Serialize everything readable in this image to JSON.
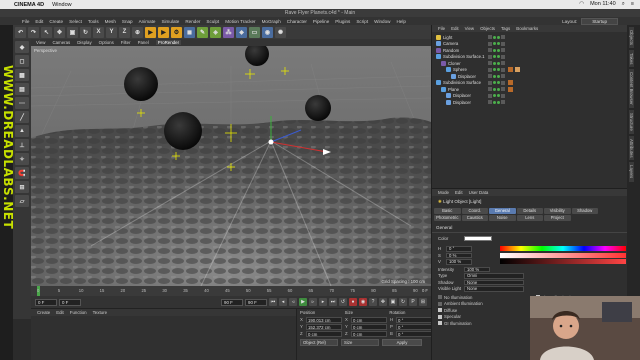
{
  "mac_menubar": {
    "app_name": "CINEMA 4D",
    "menus": [
      "Window"
    ],
    "clock": "Mon 11:40"
  },
  "window": {
    "title": "Rave Flyer Planets.c4d * - Main"
  },
  "app_menu": {
    "items": [
      "File",
      "Edit",
      "Create",
      "Select",
      "Tools",
      "Mesh",
      "Snap",
      "Animate",
      "Simulate",
      "Render",
      "Sculpt",
      "Motion Tracker",
      "MoGraph",
      "Character",
      "Pipeline",
      "Plugins",
      "Script",
      "Window",
      "Help"
    ],
    "layout_label": "Layout:",
    "layout_value": "Startup"
  },
  "toolbar": {
    "axis_buttons": [
      "X",
      "Y",
      "Z"
    ]
  },
  "watermark": {
    "text": "WWW.DREADLABS.NET"
  },
  "viewport": {
    "menu": [
      "View",
      "Cameras",
      "Display",
      "Options",
      "Filter",
      "Panel",
      "ProRender"
    ],
    "active_menu": "ProRender",
    "label": "Perspective",
    "grid_spacing": "Grid Spacing : 100 cm"
  },
  "timeline": {
    "ticks": [
      "0",
      "5",
      "10",
      "15",
      "20",
      "25",
      "30",
      "35",
      "40",
      "45",
      "50",
      "55",
      "60",
      "65",
      "70",
      "75",
      "80",
      "85",
      "90"
    ],
    "end_label": "0 F",
    "current_frame": "0 F",
    "start_field": "0 F",
    "end_field": "90 F",
    "end_field2": "90 F"
  },
  "material_panel": {
    "menu": [
      "Create",
      "Edit",
      "Function",
      "Texture"
    ]
  },
  "coordinates": {
    "headers": [
      "Position",
      "Size",
      "Rotation"
    ],
    "rows": [
      {
        "pos_key": "X",
        "pos": "190.013 cm",
        "size_key": "X",
        "size": "0 cm",
        "rot_key": "H",
        "rot": "0 °"
      },
      {
        "pos_key": "Y",
        "pos": "152.372 cm",
        "size_key": "Y",
        "size": "0 cm",
        "rot_key": "P",
        "rot": "0 °"
      },
      {
        "pos_key": "Z",
        "pos": "0 cm",
        "size_key": "Z",
        "size": "0 cm",
        "rot_key": "B",
        "rot": "0 °"
      }
    ],
    "mode_select": "Object (Rel)",
    "size_select": "Size",
    "apply_label": "Apply"
  },
  "object_manager": {
    "menu": [
      "File",
      "Edit",
      "View",
      "Objects",
      "Tags",
      "Bookmarks"
    ],
    "items": [
      {
        "name": "Light",
        "indent": 0,
        "icon_color": "#e0c040",
        "tags": 0
      },
      {
        "name": "Camera",
        "indent": 0,
        "icon_color": "#6aa0e0",
        "tags": 0
      },
      {
        "name": "Random",
        "indent": 0,
        "icon_color": "#7a5aa8",
        "tags": 0
      },
      {
        "name": "Subdivision Surface.1",
        "indent": 0,
        "icon_color": "#5aa0e0",
        "tags": 0
      },
      {
        "name": "Cloner",
        "indent": 1,
        "icon_color": "#7a5aa8",
        "tags": 0
      },
      {
        "name": "Sphere",
        "indent": 2,
        "icon_color": "#5aa0e0",
        "tags": 2
      },
      {
        "name": "Displacer",
        "indent": 3,
        "icon_color": "#6aa0e0",
        "tags": 0
      },
      {
        "name": "Subdivision Surface",
        "indent": 0,
        "icon_color": "#5aa0e0",
        "tags": 1
      },
      {
        "name": "Plane",
        "indent": 1,
        "icon_color": "#5aa0e0",
        "tags": 1
      },
      {
        "name": "Displacer",
        "indent": 2,
        "icon_color": "#6aa0e0",
        "tags": 0
      },
      {
        "name": "Displacer",
        "indent": 2,
        "icon_color": "#6aa0e0",
        "tags": 0
      }
    ]
  },
  "attribute_manager": {
    "menu": [
      "Mode",
      "Edit",
      "User Data"
    ],
    "title": "Light Object [Light]",
    "tabs": [
      "Basic",
      "Coord.",
      "General",
      "Details",
      "Visibility",
      "Shadow",
      "Photometric",
      "Caustics",
      "Noise",
      "Lens",
      "Project"
    ],
    "active_tab": "General",
    "section": "General",
    "color_label": "Color",
    "h_label": "H",
    "h_value": "0 °",
    "s_label": "S",
    "s_value": "0 %",
    "v_label": "V",
    "v_value": "100 %",
    "intensity_label": "Intensity",
    "intensity_value": "100 %",
    "type_label": "Type",
    "type_value": "Omni",
    "shadow_label": "Shadow",
    "shadow_value": "None",
    "visible_light_label": "Visible Light",
    "visible_light_value": "None",
    "left_checks": [
      "No Illumination",
      "Ambient Illumination",
      "Diffuse",
      "Specular",
      "GI Illumination"
    ],
    "left_checks_on": [
      false,
      false,
      true,
      true,
      true
    ],
    "right_checks": [
      "Show Illumination",
      "Show Visible Light",
      "Show Clipping",
      "Separate Pass",
      "Export to Compositing"
    ],
    "right_checks_on": [
      true,
      false,
      true,
      false,
      true
    ]
  },
  "side_tabs": [
    "Objects",
    "Takes",
    "Content Browser",
    "Structure",
    "Attributes",
    "Layers"
  ],
  "colors": {
    "accent_tab": "#5a7bb0",
    "watermark": "#c7e000",
    "play_green": "#3f8c3f"
  }
}
